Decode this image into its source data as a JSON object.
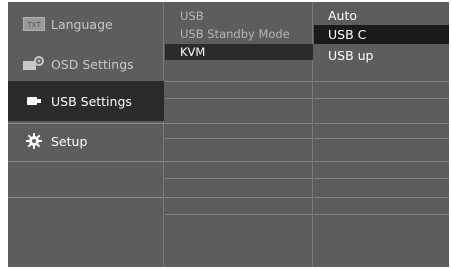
{
  "main_menu": {
    "items": [
      {
        "label": "Language",
        "icon": "txt-language-icon"
      },
      {
        "label": "OSD Settings",
        "icon": "osd-settings-icon"
      },
      {
        "label": "USB Settings",
        "icon": "usb-plug-icon"
      },
      {
        "label": "Setup",
        "icon": "gear-icon"
      }
    ],
    "active_index": 2
  },
  "sub_menu": {
    "items": [
      {
        "label": "USB"
      },
      {
        "label": "USB Standby Mode"
      },
      {
        "label": "KVM"
      }
    ],
    "active_index": 2
  },
  "options": {
    "items": [
      {
        "label": "Auto"
      },
      {
        "label": "USB C"
      },
      {
        "label": "USB up"
      }
    ],
    "selected_index": 1
  },
  "colors": {
    "panel": "#5d5d5d",
    "active": "#2b2b2b",
    "selected": "#1a1a1a",
    "text": "#ffffff",
    "dim_text": "#b6b6b6"
  }
}
